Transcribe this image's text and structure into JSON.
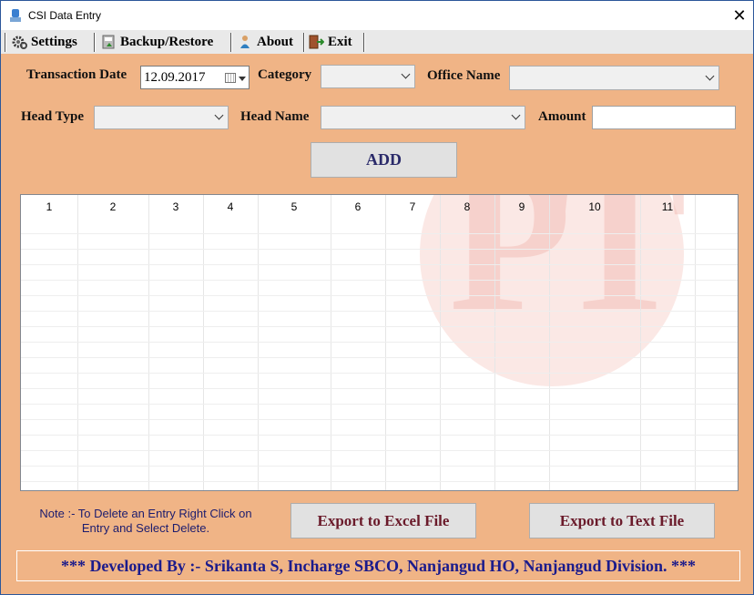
{
  "window": {
    "title": "CSI Data Entry",
    "close_glyph": "✕",
    "accent_color": "#f0b486"
  },
  "menu": {
    "settings": "Settings",
    "backup": "Backup/Restore",
    "about": "About",
    "exit": "Exit"
  },
  "form": {
    "transaction_date_label": "Transaction Date",
    "transaction_date_value": "12.09.2017",
    "category_label": "Category",
    "category_value": "",
    "office_name_label": "Office Name",
    "office_name_value": "",
    "head_type_label": "Head Type",
    "head_type_value": "",
    "head_name_label": "Head Name",
    "head_name_value": "",
    "amount_label": "Amount",
    "amount_value": "",
    "add_button": "ADD"
  },
  "grid": {
    "columns": [
      "1",
      "2",
      "3",
      "4",
      "5",
      "6",
      "7",
      "8",
      "9",
      "10",
      "11"
    ]
  },
  "bottom": {
    "note_line1": "Note :- To Delete an Entry Right Click on",
    "note_line2": "Entry and Select Delete.",
    "export_excel": "Export to Excel File",
    "export_text": "Export to Text File"
  },
  "footer": {
    "credit": "***  Developed By :- Srikanta S, Incharge SBCO, Nanjangud HO, Nanjangud Division.  ***"
  }
}
